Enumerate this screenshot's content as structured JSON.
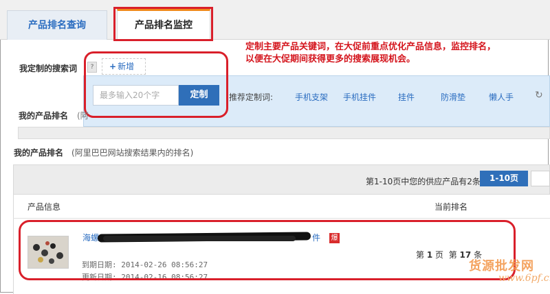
{
  "tabs": [
    {
      "label": "产品排名查询",
      "active": false
    },
    {
      "label": "产品排名监控",
      "active": true
    }
  ],
  "annotation": "定制主要产品关键词，在大促前重点优化产品信息，监控排名，以便在大促期间获得更多的搜索展现机会。",
  "search_words": {
    "label": "我定制的搜索词",
    "help_icon": "?",
    "add_label": "新增"
  },
  "custom_form": {
    "placeholder": "最多输入20个字",
    "submit_label": "定制",
    "recommend_label": "推荐定制词:",
    "recommendations": [
      "手机支架",
      "手机挂件",
      "挂件",
      "防滑垫",
      "懒人手"
    ]
  },
  "my_rank_hidden": {
    "label": "我的产品排名",
    "note": "(阿"
  },
  "my_rank": {
    "label": "我的产品排名",
    "note": "(阿里巴巴网站搜索结果内的排名)"
  },
  "results": {
    "summary": "第1-10页中您的供应产品有2条",
    "page_label": "1-10页"
  },
  "table": {
    "col_product": "产品信息",
    "col_rank": "当前排名",
    "rows": [
      {
        "title_start": "海螺",
        "title_end": "件",
        "hot_badge": "爆",
        "expiry": "到期日期: 2014-02-26 08:56:27",
        "updated": "更新日期: 2014-02-16 08:56:27",
        "page_prefix": "第",
        "page_num": "1",
        "page_suffix": "页",
        "pos_prefix": "第",
        "pos_num": "17",
        "pos_suffix": "条"
      }
    ]
  },
  "watermark": {
    "text": "货源批发网",
    "url": "www.6pf.cn"
  },
  "colors": {
    "accent_blue": "#2f6fb9",
    "annotation_red": "#d91f2a",
    "tab_orange": "#f08a1a"
  }
}
